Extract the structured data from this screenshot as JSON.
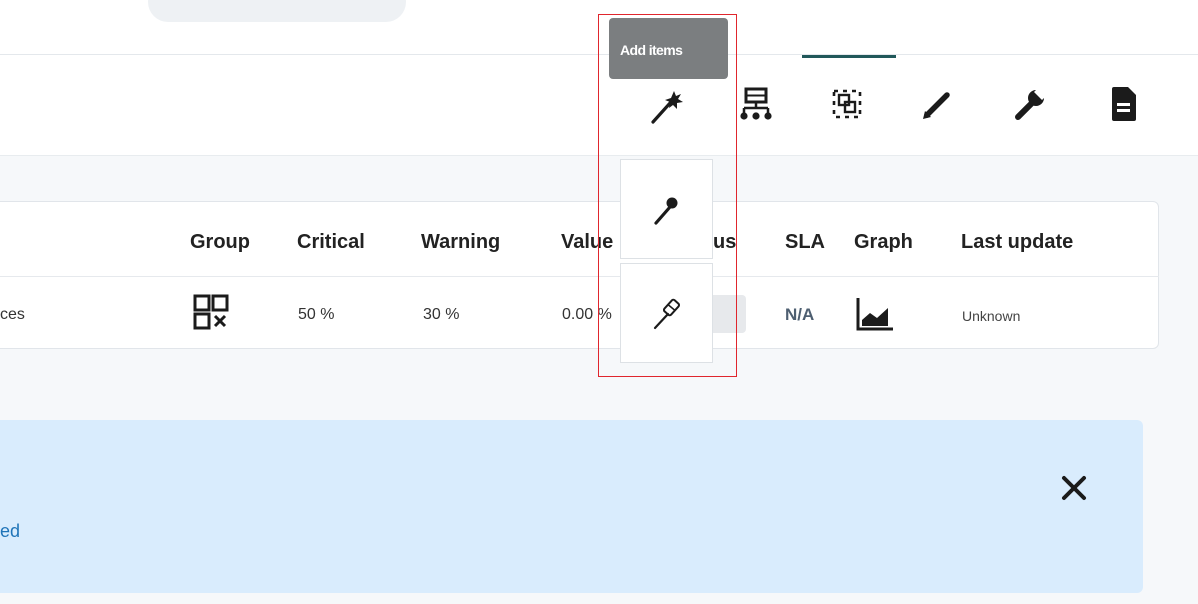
{
  "tooltip": {
    "label": "Add items"
  },
  "toolbar": {
    "icons": [
      "magic-wand-icon",
      "sitemap-icon",
      "group-select-icon",
      "pencil-icon",
      "wrench-icon",
      "document-icon"
    ],
    "active_tab_color": "#21585a"
  },
  "dropdown": {
    "items": [
      {
        "icon": "pin-icon"
      },
      {
        "icon": "pin-outline-icon"
      }
    ]
  },
  "table": {
    "headers": {
      "group": "Group",
      "critical": "Critical",
      "warning": "Warning",
      "value": "Value",
      "status": "us",
      "sla": "SLA",
      "graph": "Graph",
      "last_update": "Last update"
    },
    "row": {
      "name": "ces",
      "group_icon": "group-remove-icon",
      "critical": "50 %",
      "warning": "30 %",
      "value": "0.00 %",
      "sla": "N/A",
      "graph_icon": "area-chart-icon",
      "last_update": "Unknown"
    }
  },
  "alert": {
    "text": "ed",
    "background": "#d9ecfd",
    "text_color": "#1f74b8"
  },
  "highlight": {
    "color": "#e0262d"
  }
}
